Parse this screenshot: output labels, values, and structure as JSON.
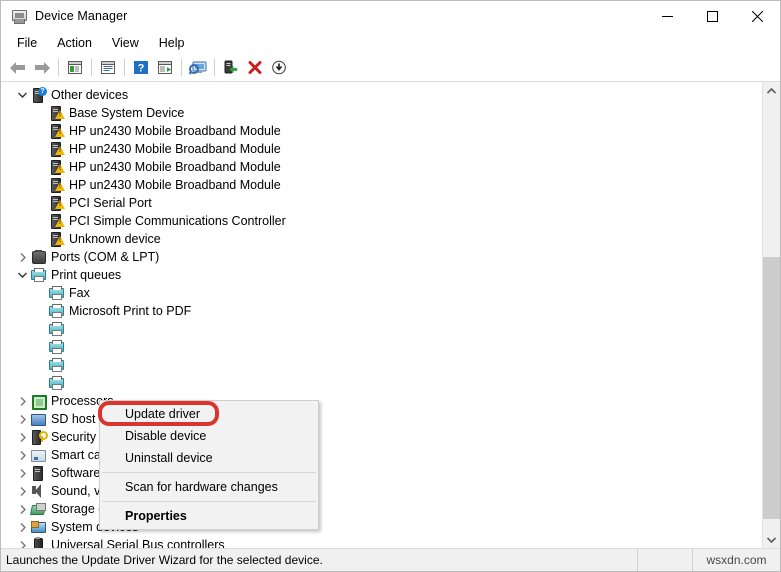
{
  "window": {
    "title": "Device Manager",
    "title_icon": "device-manager-icon",
    "controls": {
      "minimize": "minimize-icon",
      "maximize": "maximize-icon",
      "close": "close-icon"
    }
  },
  "menubar": {
    "items": [
      {
        "label": "File"
      },
      {
        "label": "Action"
      },
      {
        "label": "View"
      },
      {
        "label": "Help"
      }
    ]
  },
  "toolbar": {
    "buttons": [
      {
        "name": "back-icon",
        "tooltip": "Back"
      },
      {
        "name": "forward-icon",
        "tooltip": "Forward"
      },
      {
        "name": "show-hide-console-tree-icon",
        "tooltip": "Show/Hide Console Tree"
      },
      {
        "name": "properties-icon",
        "tooltip": "Properties"
      },
      {
        "name": "help-icon",
        "tooltip": "Help"
      },
      {
        "name": "show-hide-action-pane-icon",
        "tooltip": "Show/Hide Action Pane"
      },
      {
        "name": "scan-for-hardware-changes-icon",
        "tooltip": "Scan for hardware changes"
      },
      {
        "name": "update-driver-icon",
        "tooltip": "Update driver"
      },
      {
        "name": "uninstall-device-icon",
        "tooltip": "Uninstall device"
      },
      {
        "name": "disable-device-icon",
        "tooltip": "Disable device"
      }
    ]
  },
  "tree": {
    "rows": [
      {
        "label": "Other devices",
        "indent": 0,
        "twisty": "expanded",
        "icon": "unknown-device-icon"
      },
      {
        "label": "Base System Device",
        "indent": 1,
        "twisty": "none",
        "icon": "warning-device-icon"
      },
      {
        "label": "HP un2430 Mobile Broadband Module",
        "indent": 1,
        "twisty": "none",
        "icon": "warning-device-icon"
      },
      {
        "label": "HP un2430 Mobile Broadband Module",
        "indent": 1,
        "twisty": "none",
        "icon": "warning-device-icon"
      },
      {
        "label": "HP un2430 Mobile Broadband Module",
        "indent": 1,
        "twisty": "none",
        "icon": "warning-device-icon"
      },
      {
        "label": "HP un2430 Mobile Broadband Module",
        "indent": 1,
        "twisty": "none",
        "icon": "warning-device-icon"
      },
      {
        "label": "PCI Serial Port",
        "indent": 1,
        "twisty": "none",
        "icon": "warning-device-icon"
      },
      {
        "label": "PCI Simple Communications Controller",
        "indent": 1,
        "twisty": "none",
        "icon": "warning-device-icon"
      },
      {
        "label": "Unknown device",
        "indent": 1,
        "twisty": "none",
        "icon": "warning-device-icon"
      },
      {
        "label": "Ports (COM & LPT)",
        "indent": 0,
        "twisty": "collapsed",
        "icon": "port-icon"
      },
      {
        "label": "Print queues",
        "indent": 0,
        "twisty": "expanded",
        "icon": "printer-icon"
      },
      {
        "label": "Fax",
        "indent": 1,
        "twisty": "none",
        "icon": "printer-icon"
      },
      {
        "label": "Microsoft Print to PDF",
        "indent": 1,
        "twisty": "none",
        "icon": "printer-icon"
      },
      {
        "label": "",
        "indent": 1,
        "twisty": "none",
        "icon": "printer-icon"
      },
      {
        "label": "",
        "indent": 1,
        "twisty": "none",
        "icon": "printer-icon"
      },
      {
        "label": "",
        "indent": 1,
        "twisty": "none",
        "icon": "printer-icon"
      },
      {
        "label": "",
        "indent": 1,
        "twisty": "none",
        "icon": "printer-icon"
      },
      {
        "label": "Processors",
        "indent": 0,
        "twisty": "collapsed",
        "icon": "processor-icon"
      },
      {
        "label": "SD host adapters",
        "indent": 0,
        "twisty": "collapsed",
        "icon": "sd-host-icon"
      },
      {
        "label": "Security devices",
        "indent": 0,
        "twisty": "collapsed",
        "icon": "security-icon"
      },
      {
        "label": "Smart card readers",
        "indent": 0,
        "twisty": "collapsed",
        "icon": "smart-card-reader-icon"
      },
      {
        "label": "Software devices",
        "indent": 0,
        "twisty": "collapsed",
        "icon": "software-device-icon"
      },
      {
        "label": "Sound, video and game controllers",
        "indent": 0,
        "twisty": "collapsed",
        "icon": "sound-icon"
      },
      {
        "label": "Storage controllers",
        "indent": 0,
        "twisty": "collapsed",
        "icon": "storage-icon"
      },
      {
        "label": "System devices",
        "indent": 0,
        "twisty": "collapsed",
        "icon": "system-device-icon"
      },
      {
        "label": "Universal Serial Bus controllers",
        "indent": 0,
        "twisty": "collapsed",
        "icon": "usb-icon"
      }
    ]
  },
  "context_menu": {
    "items": [
      {
        "label": "Update driver",
        "bold": false,
        "separator_after": false,
        "highlighted": true
      },
      {
        "label": "Disable device",
        "bold": false,
        "separator_after": false,
        "highlighted": false
      },
      {
        "label": "Uninstall device",
        "bold": false,
        "separator_after": true,
        "highlighted": false
      },
      {
        "label": "Scan for hardware changes",
        "bold": false,
        "separator_after": true,
        "highlighted": false
      },
      {
        "label": "Properties",
        "bold": true,
        "separator_after": false,
        "highlighted": false
      }
    ],
    "highlight_color": "#d9352c"
  },
  "statusbar": {
    "text": "Launches the Update Driver Wizard for the selected device.",
    "watermark": "wsxdn.com"
  }
}
